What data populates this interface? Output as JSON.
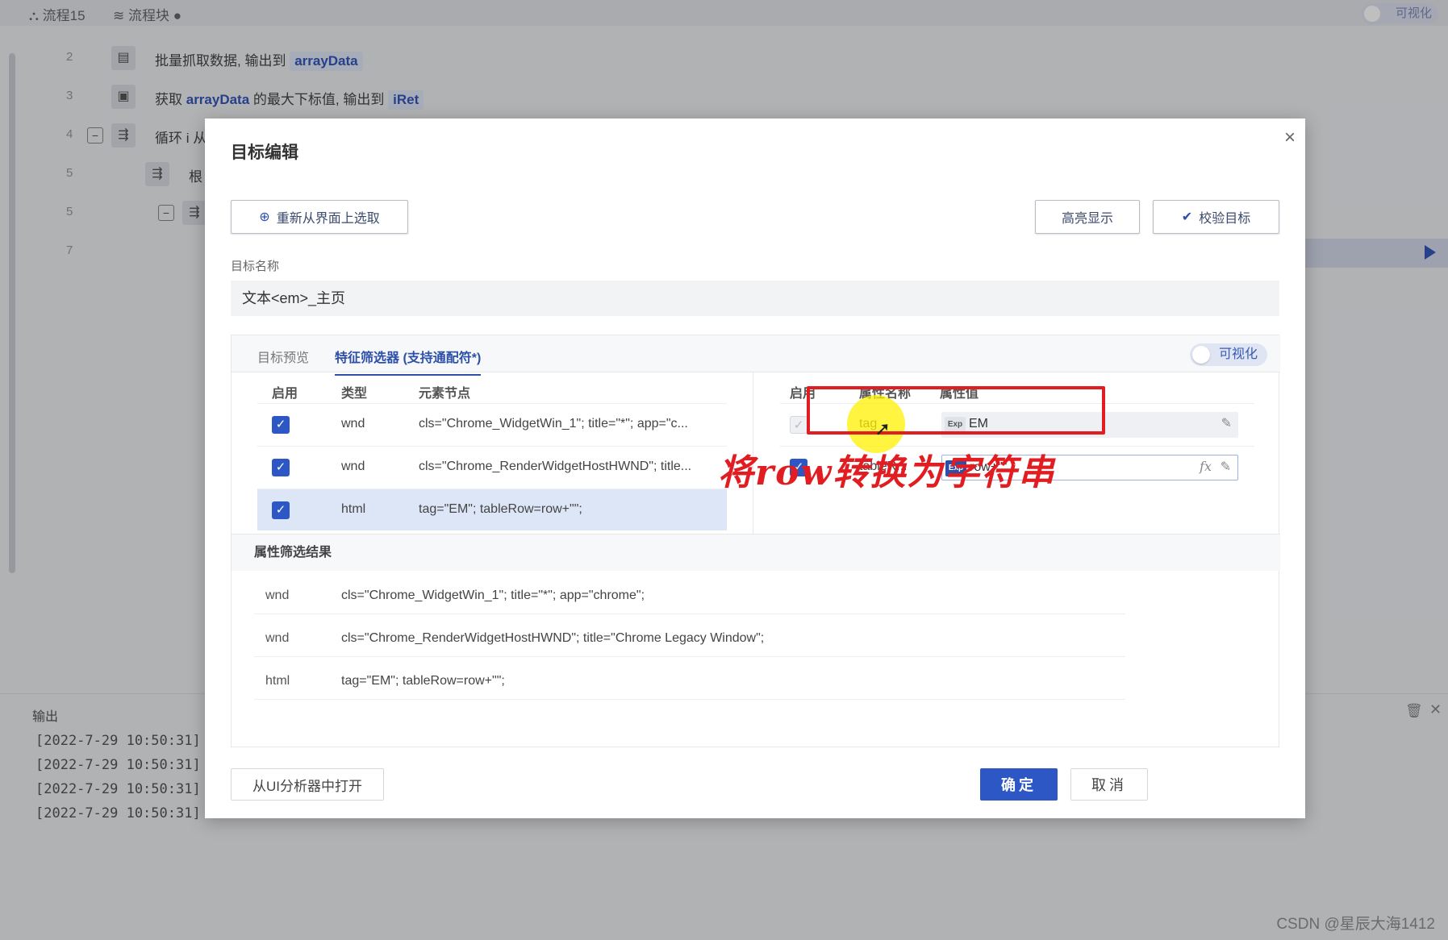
{
  "background": {
    "tabs": [
      {
        "icon": "flow-icon",
        "label": "流程15"
      },
      {
        "icon": "layers-icon",
        "label": "流程块 ●"
      }
    ],
    "visualize_toggle": "可视化",
    "rows": [
      {
        "num": "2",
        "text_prefix": "批量抓取数据, 输出到",
        "chip": "arrayData"
      },
      {
        "num": "3",
        "text_prefix": "获取",
        "strong": "arrayData",
        "text_mid": "的最大下标值, 输出到",
        "chip": "iRet"
      },
      {
        "num": "4",
        "text_prefix": "循环 i 从"
      },
      {
        "num": "5",
        "text_prefix": "根"
      },
      {
        "num": "5",
        "text_prefix": ""
      },
      {
        "num": "7",
        "text_prefix": ""
      }
    ],
    "output": {
      "title": "输出",
      "logs": [
        "[2022-7-29 10:50:31]",
        "[2022-7-29 10:50:31]",
        "[2022-7-29 10:50:31]",
        "[2022-7-29 10:50:31]"
      ]
    }
  },
  "modal": {
    "title": "目标编辑",
    "reselect_button": "重新从界面上选取",
    "highlight_button": "高亮显示",
    "verify_button": "校验目标",
    "target_name_label": "目标名称",
    "target_name_value": "文本<em>_主页",
    "tabs": {
      "preview": "目标预览",
      "filter": "特征筛选器 (支持通配符*)"
    },
    "visualize_toggle": "可视化",
    "left_table": {
      "headers": {
        "enable": "启用",
        "type": "类型",
        "node": "元素节点"
      },
      "rows": [
        {
          "enabled": true,
          "type": "wnd",
          "node": "cls=\"Chrome_WidgetWin_1\"; title=\"*\"; app=\"c..."
        },
        {
          "enabled": true,
          "type": "wnd",
          "node": "cls=\"Chrome_RenderWidgetHostHWND\"; title..."
        },
        {
          "enabled": true,
          "type": "html",
          "node": "tag=\"EM\"; tableRow=row+\"\";",
          "selected": true
        }
      ]
    },
    "right_table": {
      "headers": {
        "enable": "启用",
        "name": "属性名称",
        "value": "属性值"
      },
      "rows": [
        {
          "enabled": true,
          "disabled": true,
          "name": "tag",
          "exp": "Exp",
          "value": "EM"
        },
        {
          "enabled": true,
          "name": "tableR...",
          "exp": "Exp",
          "value": "row+\"\"",
          "fx": "fx"
        }
      ]
    },
    "annotation": "将row转换为字符串",
    "results": {
      "title": "属性筛选结果",
      "rows": [
        {
          "type": "wnd",
          "value": "cls=\"Chrome_WidgetWin_1\"; title=\"*\"; app=\"chrome\";"
        },
        {
          "type": "wnd",
          "value": "cls=\"Chrome_RenderWidgetHostHWND\"; title=\"Chrome Legacy Window\";"
        },
        {
          "type": "html",
          "value": "tag=\"EM\"; tableRow=row+\"\";"
        }
      ]
    },
    "open_analyzer_button": "从UI分析器中打开",
    "ok_button": "确定",
    "cancel_button": "取消"
  },
  "watermark": "CSDN @星辰大海1412"
}
